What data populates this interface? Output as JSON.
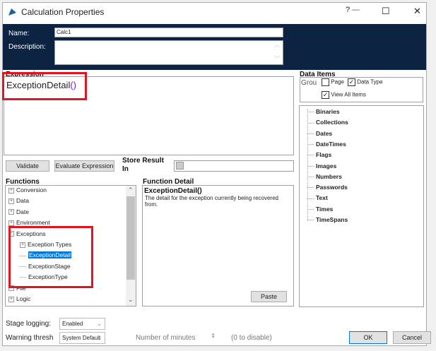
{
  "window": {
    "title": "Calculation Properties",
    "help": "?",
    "minimize": "—",
    "maximize": "☐",
    "close": "✕"
  },
  "header": {
    "name_label": "Name:",
    "name_value": "Calc1",
    "description_label": "Description:",
    "description_value": ""
  },
  "expression": {
    "label": "Expression",
    "value": "ExceptionDetail",
    "parens": "()"
  },
  "data_items": {
    "label": "Data Items",
    "group_label": "Grou",
    "page_label": "Page",
    "page_checked": false,
    "data_type_label": "Data Type",
    "data_type_checked": true,
    "view_all_label": "View All Items",
    "view_all_checked": true,
    "items": [
      "Binaries",
      "Collections",
      "Dates",
      "DateTimes",
      "Flags",
      "Images",
      "Numbers",
      "Passwords",
      "Text",
      "Times",
      "TimeSpans"
    ]
  },
  "toolbar": {
    "validate": "Validate",
    "evaluate": "Evaluate Expression",
    "store_label": "Store Result In",
    "store_value": ""
  },
  "functions": {
    "label": "Functions",
    "items": [
      {
        "label": "Conversion",
        "type": "collapsed"
      },
      {
        "label": "Data",
        "type": "collapsed"
      },
      {
        "label": "Date",
        "type": "collapsed"
      },
      {
        "label": "Environment",
        "type": "collapsed"
      },
      {
        "label": "Exceptions",
        "type": "expanded"
      },
      {
        "label": "Exception Types",
        "type": "child-collapsed"
      },
      {
        "label": "ExceptionDetail",
        "type": "child-selected"
      },
      {
        "label": "ExceptionStage",
        "type": "child"
      },
      {
        "label": "ExceptionType",
        "type": "child"
      },
      {
        "label": "File",
        "type": "collapsed"
      },
      {
        "label": "Logic",
        "type": "collapsed"
      }
    ]
  },
  "function_detail": {
    "label": "Function Detail",
    "name": "ExceptionDetail()",
    "description": "The detail for the exception currently being recovered from.",
    "paste": "Paste"
  },
  "footer": {
    "stage_logging_label": "Stage logging:",
    "stage_logging_value": "Enabled",
    "warning_label": "Warning thresh",
    "warning_value": "System Default",
    "minutes_label": "Number of minutes",
    "minutes_value": "",
    "disable_hint": "(0 to disable)",
    "ok": "OK",
    "cancel": "Cancel"
  },
  "colors": {
    "band": "#0c2341",
    "highlight": "#e0151f",
    "selection": "#0078d7"
  }
}
